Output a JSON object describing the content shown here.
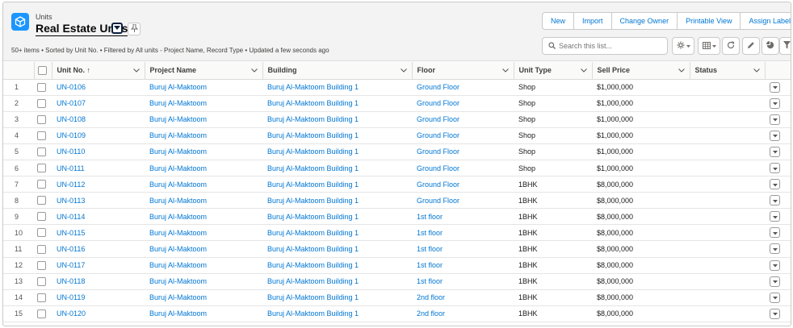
{
  "header": {
    "object_label": "Units",
    "list_title": "Real Estate Units",
    "meta": "50+ items • Sorted by Unit No. • Filtered by All units - Project Name, Record Type • Updated a few seconds ago",
    "actions": [
      "New",
      "Import",
      "Change Owner",
      "Printable View",
      "Assign Label"
    ],
    "search_placeholder": "Search this list..."
  },
  "colors": {
    "accent": "#0176d3",
    "object_icon": "#1b96ff"
  },
  "icons": {
    "object": "cube-icon",
    "pin": "pin-icon",
    "search": "search-icon",
    "settings": "gear-icon",
    "display": "table-icon",
    "refresh": "refresh-icon",
    "edit": "pencil-icon",
    "chart": "chart-icon",
    "filter": "filter-icon"
  },
  "table": {
    "columns": [
      "Unit No.",
      "Project Name",
      "Building",
      "Floor",
      "Unit Type",
      "Sell Price",
      "Status"
    ],
    "sort_indicator": "↑",
    "rows": [
      {
        "n": "1",
        "unit": "UN-0106",
        "project": "Buruj Al-Maktoom",
        "building": "Buruj Al-Maktoom Building 1",
        "floor": "Ground Floor",
        "type": "Shop",
        "price": "$1,000,000",
        "status": ""
      },
      {
        "n": "2",
        "unit": "UN-0107",
        "project": "Buruj Al-Maktoom",
        "building": "Buruj Al-Maktoom Building 1",
        "floor": "Ground Floor",
        "type": "Shop",
        "price": "$1,000,000",
        "status": ""
      },
      {
        "n": "3",
        "unit": "UN-0108",
        "project": "Buruj Al-Maktoom",
        "building": "Buruj Al-Maktoom Building 1",
        "floor": "Ground Floor",
        "type": "Shop",
        "price": "$1,000,000",
        "status": ""
      },
      {
        "n": "4",
        "unit": "UN-0109",
        "project": "Buruj Al-Maktoom",
        "building": "Buruj Al-Maktoom Building 1",
        "floor": "Ground Floor",
        "type": "Shop",
        "price": "$1,000,000",
        "status": ""
      },
      {
        "n": "5",
        "unit": "UN-0110",
        "project": "Buruj Al-Maktoom",
        "building": "Buruj Al-Maktoom Building 1",
        "floor": "Ground Floor",
        "type": "Shop",
        "price": "$1,000,000",
        "status": ""
      },
      {
        "n": "6",
        "unit": "UN-0111",
        "project": "Buruj Al-Maktoom",
        "building": "Buruj Al-Maktoom Building 1",
        "floor": "Ground Floor",
        "type": "Shop",
        "price": "$1,000,000",
        "status": ""
      },
      {
        "n": "7",
        "unit": "UN-0112",
        "project": "Buruj Al-Maktoom",
        "building": "Buruj Al-Maktoom Building 1",
        "floor": "Ground Floor",
        "type": "1BHK",
        "price": "$8,000,000",
        "status": ""
      },
      {
        "n": "8",
        "unit": "UN-0113",
        "project": "Buruj Al-Maktoom",
        "building": "Buruj Al-Maktoom Building 1",
        "floor": "Ground Floor",
        "type": "1BHK",
        "price": "$8,000,000",
        "status": ""
      },
      {
        "n": "9",
        "unit": "UN-0114",
        "project": "Buruj Al-Maktoom",
        "building": "Buruj Al-Maktoom Building 1",
        "floor": "1st floor",
        "type": "1BHK",
        "price": "$8,000,000",
        "status": ""
      },
      {
        "n": "10",
        "unit": "UN-0115",
        "project": "Buruj Al-Maktoom",
        "building": "Buruj Al-Maktoom Building 1",
        "floor": "1st floor",
        "type": "1BHK",
        "price": "$8,000,000",
        "status": ""
      },
      {
        "n": "11",
        "unit": "UN-0116",
        "project": "Buruj Al-Maktoom",
        "building": "Buruj Al-Maktoom Building 1",
        "floor": "1st floor",
        "type": "1BHK",
        "price": "$8,000,000",
        "status": ""
      },
      {
        "n": "12",
        "unit": "UN-0117",
        "project": "Buruj Al-Maktoom",
        "building": "Buruj Al-Maktoom Building 1",
        "floor": "1st floor",
        "type": "1BHK",
        "price": "$8,000,000",
        "status": ""
      },
      {
        "n": "13",
        "unit": "UN-0118",
        "project": "Buruj Al-Maktoom",
        "building": "Buruj Al-Maktoom Building 1",
        "floor": "1st floor",
        "type": "1BHK",
        "price": "$8,000,000",
        "status": ""
      },
      {
        "n": "14",
        "unit": "UN-0119",
        "project": "Buruj Al-Maktoom",
        "building": "Buruj Al-Maktoom Building 1",
        "floor": "2nd floor",
        "type": "1BHK",
        "price": "$8,000,000",
        "status": ""
      },
      {
        "n": "15",
        "unit": "UN-0120",
        "project": "Buruj Al-Maktoom",
        "building": "Buruj Al-Maktoom Building 1",
        "floor": "2nd floor",
        "type": "1BHK",
        "price": "$8,000,000",
        "status": ""
      }
    ]
  }
}
